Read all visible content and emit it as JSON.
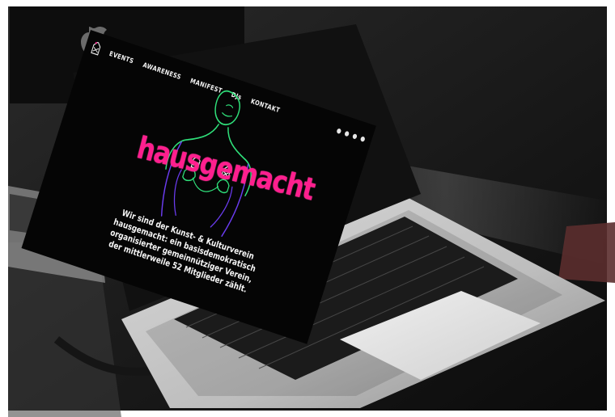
{
  "site": {
    "brand": "hausgemacht",
    "nav": [
      {
        "label": "EVENTS"
      },
      {
        "label": "AWARENESS"
      },
      {
        "label": "MANIFEST"
      },
      {
        "label": "DJs"
      },
      {
        "label": "KONTAKT"
      }
    ],
    "social_icons": [
      "facebook-icon",
      "instagram-icon",
      "soundcloud-icon",
      "link-icon"
    ],
    "intro_lines": [
      "Wir sind der Kunst- & Kulturverein",
      "hausgemacht: ein basisdemokratisch",
      "organisierter gemeinnütziger Verein,",
      "der mittlerweile 52 Mitglieder zählt."
    ]
  },
  "colors": {
    "accent_pink": "#ff1f8e",
    "figure_green": "#2fe07a",
    "figure_purple": "#6b3cf0",
    "screen_bg": "#050505"
  }
}
